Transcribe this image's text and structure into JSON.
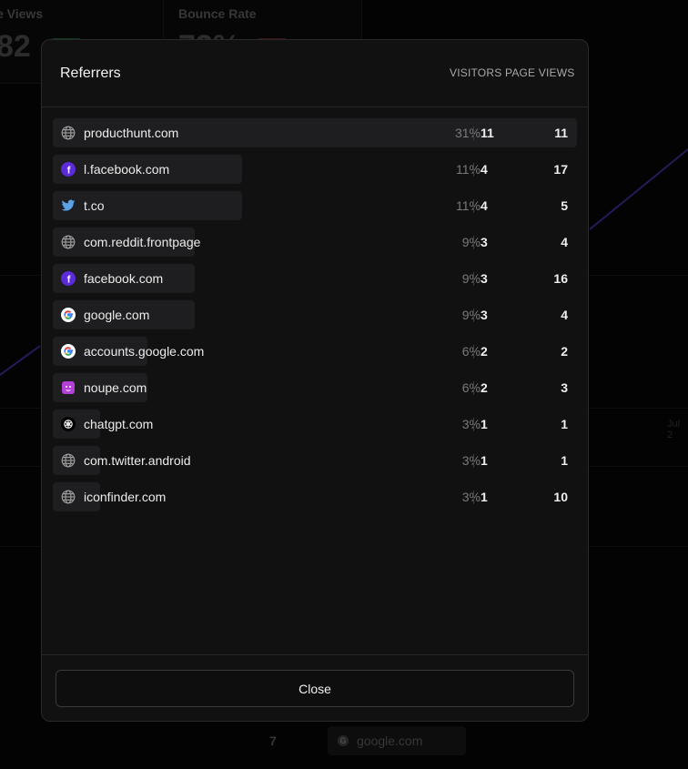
{
  "background": {
    "cards": [
      {
        "label": "e Views",
        "value": "82",
        "badge_color": "#1f5a2e"
      },
      {
        "label": "Bounce Rate",
        "value": "73%",
        "badge_color": "#5a1f1f"
      }
    ],
    "bottom_number": "7",
    "bottom_chip": "google.com",
    "axis_tick": "Jul 2"
  },
  "modal": {
    "title": "Referrers",
    "columns": {
      "visitors": "VISITORS",
      "page_views": "PAGE VIEWS"
    },
    "close_label": "Close",
    "rows": [
      {
        "name": "producthunt.com",
        "percent": "31%",
        "visitors": "11",
        "page_views": "11",
        "icon": "globe-icon",
        "share": 1.0
      },
      {
        "name": "l.facebook.com",
        "percent": "11%",
        "visitors": "4",
        "page_views": "17",
        "icon": "facebook-icon",
        "share": 0.364
      },
      {
        "name": "t.co",
        "percent": "11%",
        "visitors": "4",
        "page_views": "5",
        "icon": "twitter-icon",
        "share": 0.364
      },
      {
        "name": "com.reddit.frontpage",
        "percent": "9%",
        "visitors": "3",
        "page_views": "4",
        "icon": "globe-icon",
        "share": 0.273
      },
      {
        "name": "facebook.com",
        "percent": "9%",
        "visitors": "3",
        "page_views": "16",
        "icon": "facebook-icon",
        "share": 0.273
      },
      {
        "name": "google.com",
        "percent": "9%",
        "visitors": "3",
        "page_views": "4",
        "icon": "google-icon",
        "share": 0.273
      },
      {
        "name": "accounts.google.com",
        "percent": "6%",
        "visitors": "2",
        "page_views": "2",
        "icon": "google-icon",
        "share": 0.182
      },
      {
        "name": "noupe.com",
        "percent": "6%",
        "visitors": "2",
        "page_views": "3",
        "icon": "noupe-icon",
        "share": 0.182
      },
      {
        "name": "chatgpt.com",
        "percent": "3%",
        "visitors": "1",
        "page_views": "1",
        "icon": "chatgpt-icon",
        "share": 0.091
      },
      {
        "name": "com.twitter.android",
        "percent": "3%",
        "visitors": "1",
        "page_views": "1",
        "icon": "globe-icon",
        "share": 0.091
      },
      {
        "name": "iconfinder.com",
        "percent": "3%",
        "visitors": "1",
        "page_views": "10",
        "icon": "globe-icon",
        "share": 0.091
      }
    ]
  },
  "colors": {
    "facebook": "#5b2bd9",
    "twitter": "#5aa3e8",
    "noupe": "#b23fd6",
    "globe": "#9a9a9a"
  }
}
